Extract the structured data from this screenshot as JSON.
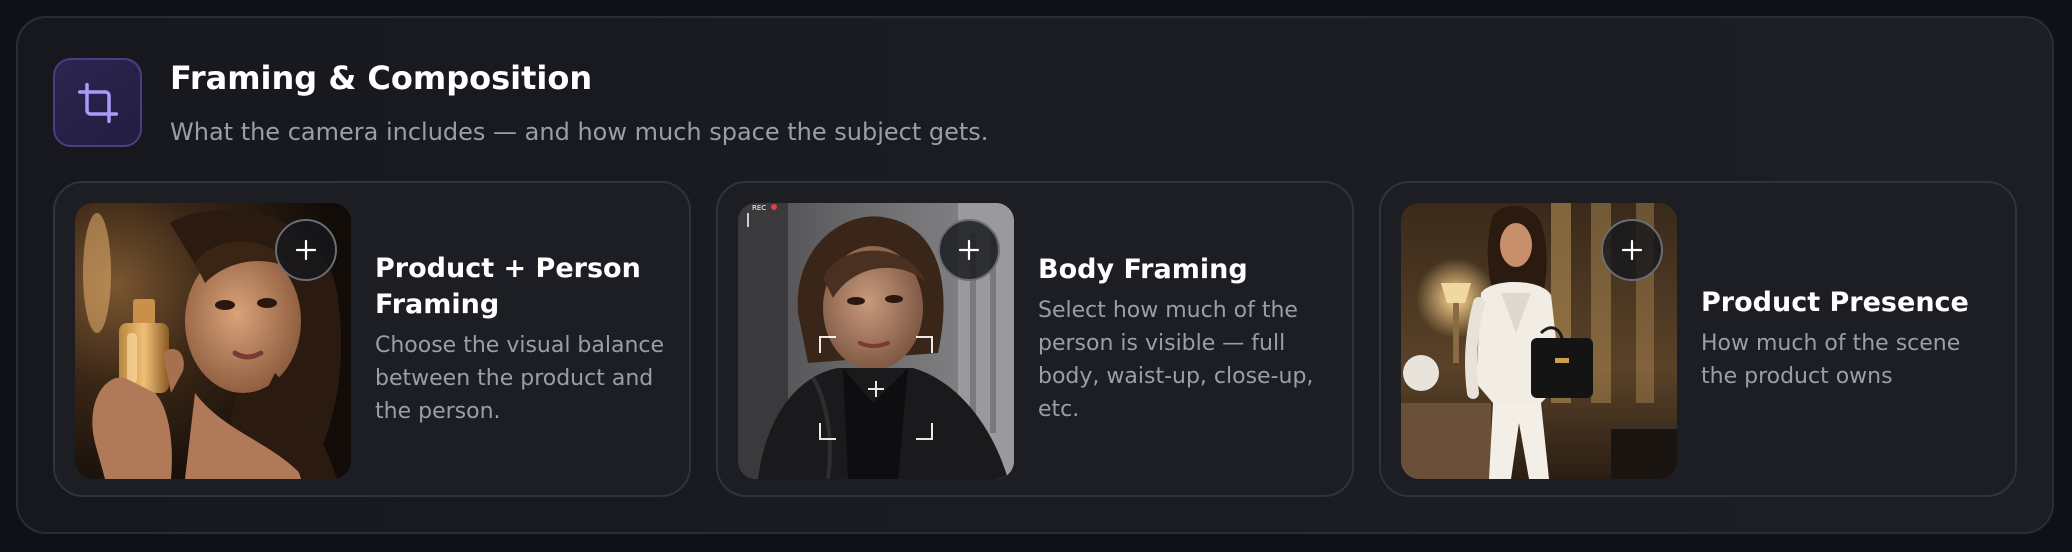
{
  "section": {
    "icon": "crop-icon",
    "title": "Framing & Composition",
    "subtitle": "What the camera includes — and how much space the subject gets."
  },
  "cards": [
    {
      "title": "Product + Person Framing",
      "description": "Choose the visual balance between the product and the person.",
      "image": "woman-holding-perfume-bottle-photo",
      "action_icon": "plus-icon"
    },
    {
      "title": "Body Framing",
      "description": "Select how much of the person is visible — full body, waist-up, close-up, etc.",
      "image": "woman-in-camera-viewfinder-photo",
      "viewfinder_label": "REC",
      "action_icon": "plus-icon"
    },
    {
      "title": "Product Presence",
      "description": "How much of the scene the product owns",
      "image": "woman-walking-with-handbag-photo",
      "action_icon": "plus-icon"
    }
  ],
  "colors": {
    "background": "#0f1118",
    "panel": "#1a1c22",
    "card": "#1c1e24",
    "accent": "#8b7cf6",
    "title_text": "#ffffff",
    "muted_text": "#9a9ea8"
  }
}
